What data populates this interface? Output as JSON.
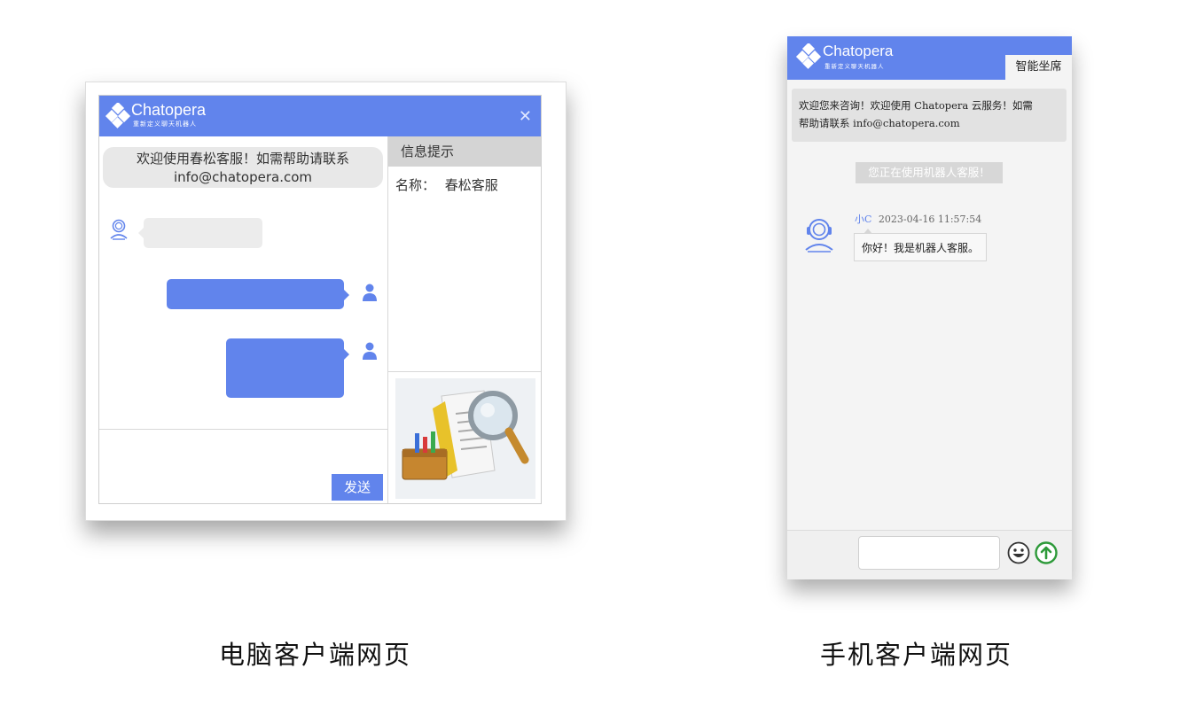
{
  "brand": {
    "name": "Chatopera",
    "tagline": "重新定义聊天机器人",
    "color": "#6184ec"
  },
  "desktop": {
    "close_icon": "close-icon",
    "welcome_line1": "欢迎使用春松客服！如需帮助请联系",
    "welcome_line2": "info@chatopera.com",
    "send_label": "发送",
    "side_title": "信息提示",
    "side_name_label": "名称：",
    "side_name_value": "春松客服"
  },
  "mobile": {
    "tab_label": "智能坐席",
    "welcome_line1": "欢迎您来咨询！欢迎使用 Chatopera 云服务！如需",
    "welcome_line2": "帮助请联系 info@chatopera.com",
    "notice": "您正在使用机器人客服！",
    "sender_name": "小C",
    "sender_time": "2023-04-16 11:57:54",
    "message": "你好！我是机器人客服。",
    "input_value": "",
    "send_icon_color": "#2e9a3a"
  },
  "captions": {
    "desktop": "电脑客户端网页",
    "mobile": "手机客户端网页"
  }
}
